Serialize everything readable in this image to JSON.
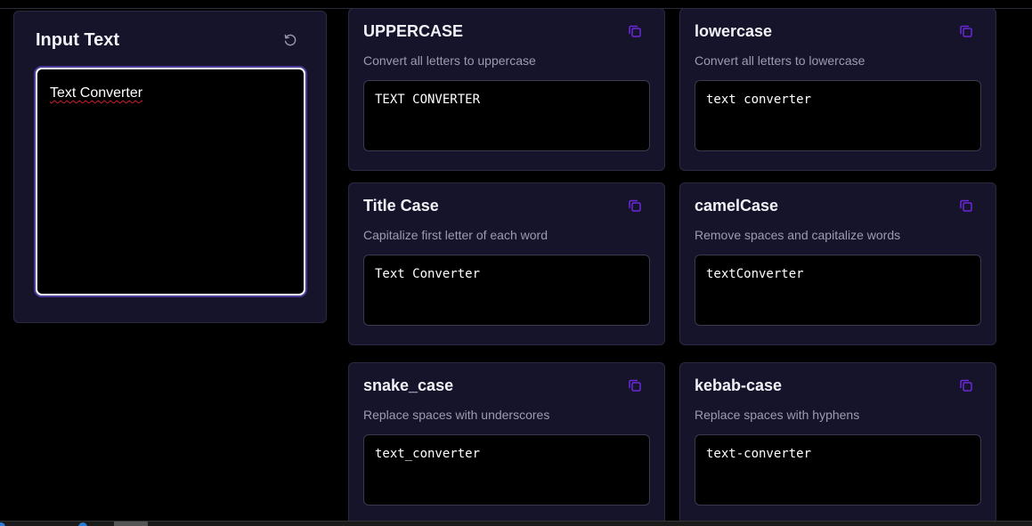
{
  "input": {
    "title": "Input Text",
    "value": "Text Converter",
    "reset_icon": "reset-icon"
  },
  "converters": [
    {
      "title": "UPPERCASE",
      "description": "Convert all letters to uppercase",
      "output": "TEXT CONVERTER"
    },
    {
      "title": "lowercase",
      "description": "Convert all letters to lowercase",
      "output": "text converter"
    },
    {
      "title": "Title Case",
      "description": "Capitalize first letter of each word",
      "output": "Text Converter"
    },
    {
      "title": "camelCase",
      "description": "Remove spaces and capitalize words",
      "output": "textConverter"
    },
    {
      "title": "snake_case",
      "description": "Replace spaces with underscores",
      "output": "text_converter"
    },
    {
      "title": "kebab-case",
      "description": "Replace spaces with hyphens",
      "output": "text-converter"
    }
  ],
  "icons": {
    "copy": "copy-icon",
    "reset": "reset-icon"
  },
  "colors": {
    "background": "#000000",
    "card": "#15142a",
    "accent": "#6d28d9",
    "focus_ring": "#4b3a9a",
    "muted_text": "#9c9cb0"
  }
}
